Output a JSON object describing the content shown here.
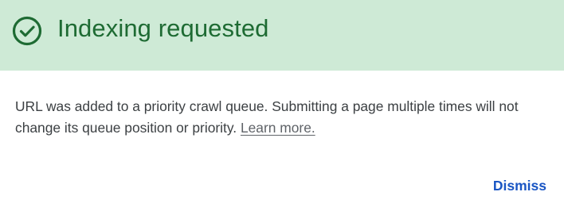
{
  "header": {
    "icon": "check-circle-icon",
    "title": "Indexing requested",
    "background_color": "#ceead6",
    "accent_color": "#1e6b33"
  },
  "body": {
    "message": "URL was added to a priority crawl queue. Submitting a page multiple times will not change its queue position or priority.",
    "learn_more_label": "Learn more."
  },
  "actions": {
    "dismiss_label": "Dismiss",
    "dismiss_color": "#1a56c4"
  }
}
